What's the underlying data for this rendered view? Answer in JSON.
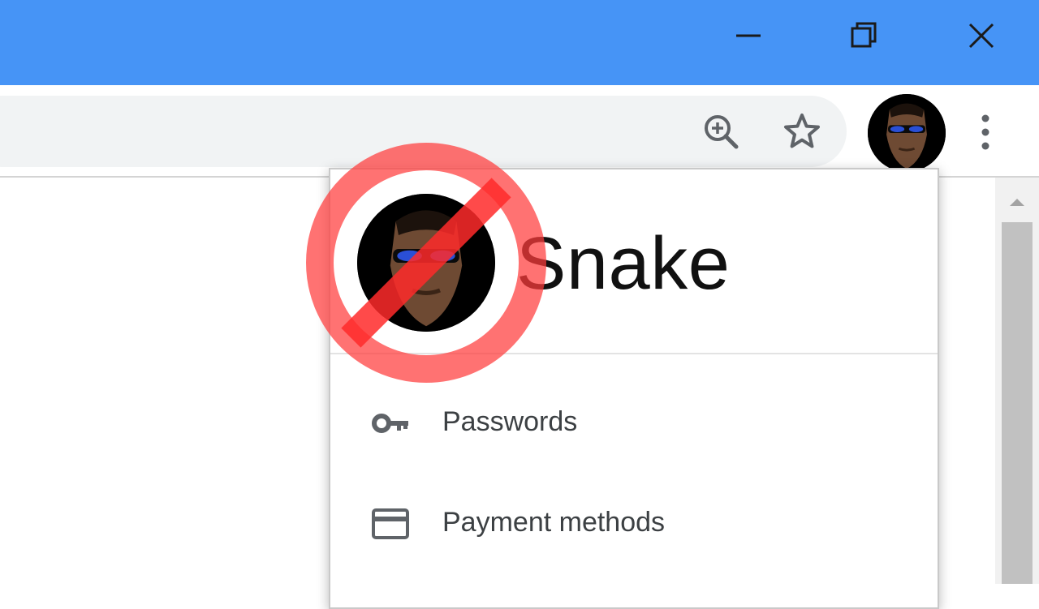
{
  "window": {
    "controls": [
      {
        "name": "minimize"
      },
      {
        "name": "restore"
      },
      {
        "name": "close"
      }
    ]
  },
  "toolbar": {
    "icons": [
      "zoom-in-icon",
      "bookmark-star-icon",
      "profile-avatar",
      "more-menu-icon"
    ]
  },
  "profile_menu": {
    "name": "Snake",
    "items": [
      {
        "label": "Passwords",
        "icon": "key-icon"
      },
      {
        "label": "Payment methods",
        "icon": "credit-card-icon"
      }
    ]
  },
  "overlay": {
    "symbol": "prohibition-sign",
    "color": "#ff3b3b"
  },
  "colors": {
    "titlebar": "#4694f6",
    "omnibox": "#f1f3f4"
  }
}
